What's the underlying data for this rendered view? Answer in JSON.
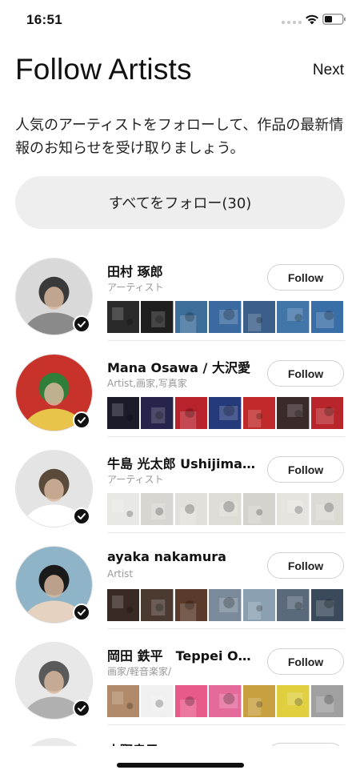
{
  "status_bar": {
    "time": "16:51"
  },
  "header": {
    "title": "Follow Artists",
    "next_label": "Next"
  },
  "subtitle": "人気のアーティストをフォローして、作品の最新情報のお知らせを受け取りましょう。",
  "follow_all_label": "すべてをフォロー(30)",
  "artists": [
    {
      "name": "田村 琢郎",
      "role": "アーティスト",
      "follow_label": "Follow",
      "avatar_colors": [
        "#d9d9d9",
        "#3a3a3a",
        "#8a8a8a"
      ],
      "thumb_colors": [
        "#2a2a2a",
        "#1e1e1e",
        "#3d6e9a",
        "#3a6aa0",
        "#3b5f88",
        "#4275a8",
        "#3a6ea6"
      ]
    },
    {
      "name": "Mana Osawa / 大沢愛",
      "role": "Artist,画家,写真家",
      "follow_label": "Follow",
      "avatar_colors": [
        "#c7332b",
        "#2f7f3a",
        "#e9c44a"
      ],
      "thumb_colors": [
        "#1b1b2a",
        "#26244a",
        "#b8222c",
        "#243a7a",
        "#c02a2a",
        "#3a2a2a",
        "#b8262c"
      ]
    },
    {
      "name": "牛島 光太郎 Ushijima K…",
      "role": "アーティスト",
      "follow_label": "Follow",
      "avatar_colors": [
        "#e4e4e4",
        "#5a4a3a",
        "#ffffff"
      ],
      "thumb_colors": [
        "#e8e8e4",
        "#d8d6d0",
        "#e2e0da",
        "#dedcd6",
        "#d4d2cc",
        "#e6e4de",
        "#dcdad4"
      ]
    },
    {
      "name": "ayaka nakamura",
      "role": "Artist",
      "follow_label": "Follow",
      "avatar_colors": [
        "#8fb3c7",
        "#1a1a1a",
        "#e6d2c0"
      ],
      "thumb_colors": [
        "#3a2a24",
        "#4a3a30",
        "#5a3a2a",
        "#7a8a9a",
        "#8aa0b0",
        "#5a6a7a",
        "#3a4a5a"
      ]
    },
    {
      "name": "岡田 鉄平　Teppei Okada",
      "role": "画家/軽音楽家/",
      "follow_label": "Follow",
      "avatar_colors": [
        "#e8e8e8",
        "#5a5a5a",
        "#b0b0b0"
      ],
      "thumb_colors": [
        "#b08a6a",
        "#f0f0f0",
        "#e85a8a",
        "#e46a9a",
        "#c8a040",
        "#e0d040",
        "#a0a0a0"
      ]
    }
  ],
  "partial_artist": {
    "name": "小野幸子"
  }
}
